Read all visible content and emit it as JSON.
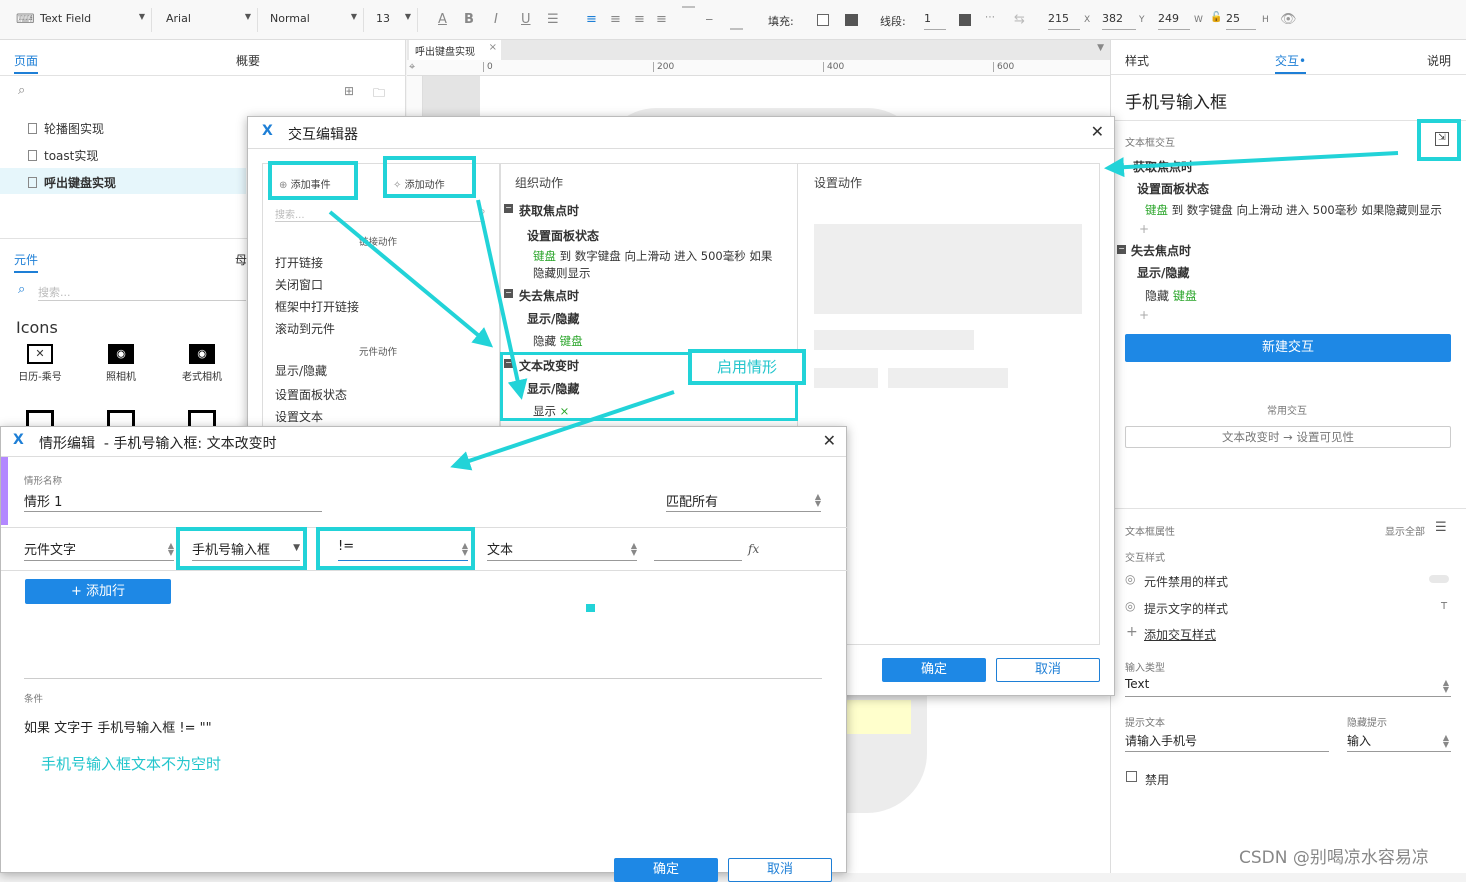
{
  "toolbar": {
    "widget_type": "Text Field",
    "font": "Arial",
    "style": "Normal",
    "size": "13",
    "fill_label": "填充:",
    "stroke_label": "线段:",
    "stroke_val": "1",
    "x": "215",
    "x_unit": "X",
    "y": "382",
    "y_unit": "Y",
    "w": "249",
    "w_unit": "W",
    "h": "25",
    "h_unit": "H"
  },
  "left": {
    "tab_pages": "页面",
    "tab_outline": "概要",
    "pages": [
      "轮播图实现",
      "toast实现",
      "呼出键盘实现"
    ],
    "tab_widgets": "元件",
    "tab_masters": "母",
    "search_placeholder": "搜索...",
    "lib_title": "Icons",
    "widgets": [
      "日历-乘号",
      "照相机",
      "老式相机"
    ]
  },
  "canvas": {
    "tab": "呼出键盘实现",
    "ruler": [
      "0",
      "200",
      "400",
      "600"
    ]
  },
  "right": {
    "tab_style": "样式",
    "tab_interact": "交互•",
    "tab_notes": "说明",
    "widget_name": "手机号输入框",
    "section_label": "文本框交互",
    "ev1": "获取焦点时",
    "ev1_action": "设置面板状态",
    "ev1_target": "键盘",
    "ev1_detail": "到 数字键盘 向上滑动 进入 500毫秒 如果隐藏则显示",
    "ev2": "失去焦点时",
    "ev2_action": "显示/隐藏",
    "ev2_detail": "隐藏",
    "ev2_target": "键盘",
    "plus": "+",
    "new_interaction": "新建交互",
    "common_label": "常用交互",
    "common_item": "文本改变时 → 设置可见性",
    "props_label": "文本框属性",
    "show_all": "显示全部",
    "interact_style_label": "交互样式",
    "disabled_style": "元件禁用的样式",
    "hint_style": "提示文字的样式",
    "hint_style_mark": "T",
    "add_interact_style": "添加交互样式",
    "input_type_label": "输入类型",
    "input_type": "Text",
    "hint_text_label": "提示文本",
    "hint_text": "请输入手机号",
    "hide_hint_label": "隐藏提示",
    "hide_hint": "输入",
    "disabled_label": "禁用"
  },
  "editor": {
    "title": "交互编辑器",
    "add_event": "添加事件",
    "add_action": "添加动作",
    "search": "搜索...",
    "link_section": "链接动作",
    "link_actions": [
      "打开链接",
      "关闭窗口",
      "框架中打开链接",
      "滚动到元件"
    ],
    "widget_section": "元件动作",
    "widget_actions": [
      "显示/隐藏",
      "设置面板状态",
      "设置文本"
    ],
    "organize": "组织动作",
    "setup": "设置动作",
    "ev1": "获取焦点时",
    "ev1_action": "设置面板状态",
    "ev1_target": "键盘",
    "ev1_detail": "到 数字键盘 向上滑动 进入 500毫秒 如果",
    "ev1_detail2": "隐藏则显示",
    "ev2": "失去焦点时",
    "ev2_action": "显示/隐藏",
    "ev2_detail": "隐藏",
    "ev2_target": "键盘",
    "ev3": "文本改变时",
    "ev3_action": "显示/隐藏",
    "ev3_detail": "显示",
    "ev3_x": "×",
    "enable_case": "启用情形",
    "ok": "确定",
    "cancel": "取消"
  },
  "case_editor": {
    "title": "情形编辑",
    "subtitle": "-   手机号输入框: 文本改变时",
    "name_label": "情形名称",
    "name": "情形 1",
    "match": "匹配所有",
    "col1": "元件文字",
    "col2": "手机号输入框",
    "col3": "!=",
    "col4": "文本",
    "fx": "fx",
    "add_row": "+ 添加行",
    "cond_label": "条件",
    "cond_text": "如果 文字于 手机号输入框 != \"\"",
    "note": "手机号输入框文本不为空时",
    "ok": "确定",
    "cancel": "取消"
  },
  "watermark": "CSDN @别喝凉水容易凉",
  "colors": {
    "accent": "#1e88e5",
    "highlight": "#22d3d8",
    "green": "#2aa52a"
  }
}
